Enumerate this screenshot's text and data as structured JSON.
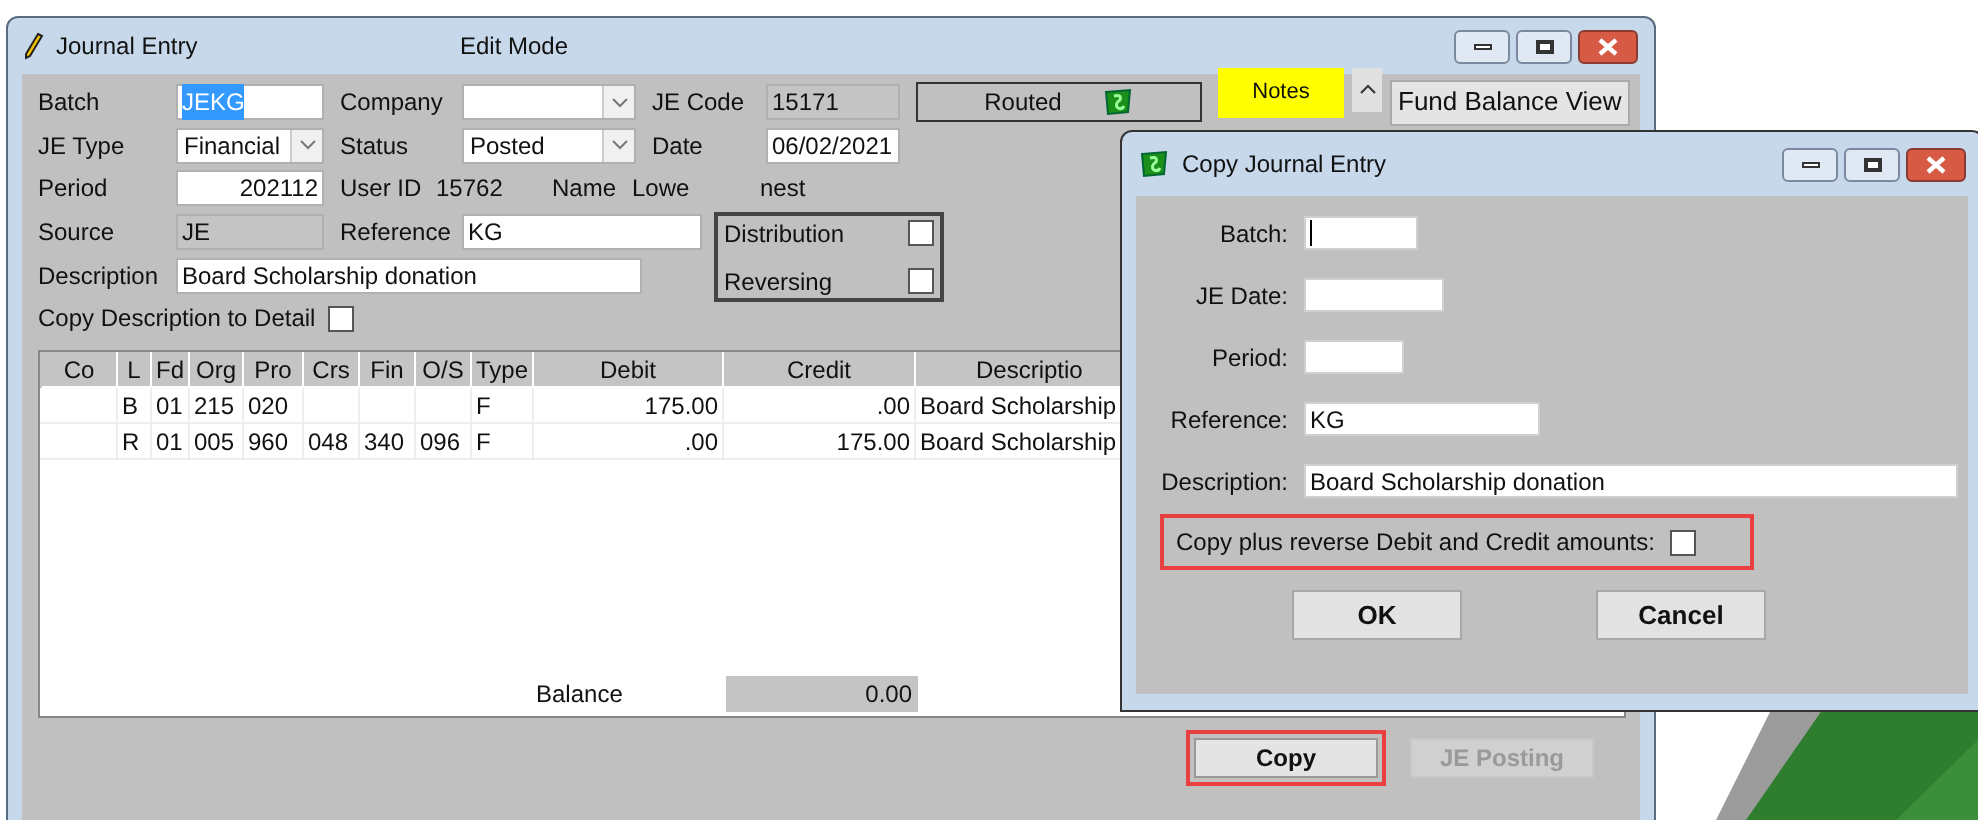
{
  "main_window": {
    "title": "Journal Entry",
    "mode": "Edit Mode"
  },
  "header": {
    "batch": {
      "label": "Batch",
      "value": "JEKG",
      "selected": true
    },
    "company": {
      "label": "Company"
    },
    "je_code": {
      "label": "JE Code",
      "value": "15171"
    },
    "routed": {
      "label": "Routed"
    },
    "notes": {
      "label": "Notes"
    },
    "fund_balance_view": {
      "label": "Fund Balance View"
    },
    "je_type": {
      "label": "JE Type",
      "value": "Financial"
    },
    "status": {
      "label": "Status",
      "value": "Posted"
    },
    "date": {
      "label": "Date",
      "value": "06/02/2021"
    },
    "period": {
      "label": "Period",
      "value": "202112"
    },
    "user_id": {
      "label": "User ID",
      "value": "15762"
    },
    "name": {
      "label": "Name",
      "value_parts": [
        "Lowe",
        "nest"
      ]
    },
    "source": {
      "label": "Source",
      "value": "JE"
    },
    "reference": {
      "label": "Reference",
      "value": "KG"
    },
    "distribution": {
      "label": "Distribution",
      "checked": false
    },
    "reversing": {
      "label": "Reversing",
      "checked": false
    },
    "description": {
      "label": "Description",
      "value": "Board Scholarship donation"
    },
    "copy_description": {
      "label": "Copy Description to Detail",
      "checked": false
    }
  },
  "table": {
    "columns": [
      "Co",
      "L",
      "Fd",
      "Org",
      "Pro",
      "Crs",
      "Fin",
      "O/S",
      "Type",
      "Debit",
      "Credit",
      "Descriptio"
    ],
    "rows": [
      [
        null,
        "B",
        "01",
        "215",
        "020",
        null,
        null,
        null,
        "F",
        "175.00",
        ".00",
        "Board Scholarship"
      ],
      [
        null,
        "R",
        "01",
        "005",
        "960",
        "048",
        "340",
        "096",
        "F",
        ".00",
        "175.00",
        "Board Scholarship"
      ]
    ]
  },
  "balance": {
    "label": "Balance",
    "value": "0.00"
  },
  "buttons": [
    {
      "label": "Copy",
      "disabled": false,
      "highlighted": true
    },
    {
      "label": "JE Posting",
      "disabled": true,
      "highlighted": false
    }
  ],
  "dialog": {
    "title": "Copy Journal Entry",
    "fields": [
      {
        "label": "Batch:",
        "focused": true
      },
      {
        "label": "JE Date:"
      },
      {
        "label": "Period:"
      },
      {
        "label": "Reference:",
        "value": "KG"
      },
      {
        "label": "Description:",
        "value": "Board Scholarship donation"
      }
    ],
    "reverse": {
      "label": "Copy plus reverse Debit and Credit amounts:",
      "checked": false,
      "highlighted": true
    },
    "buttons": [
      "OK",
      "Cancel"
    ]
  }
}
